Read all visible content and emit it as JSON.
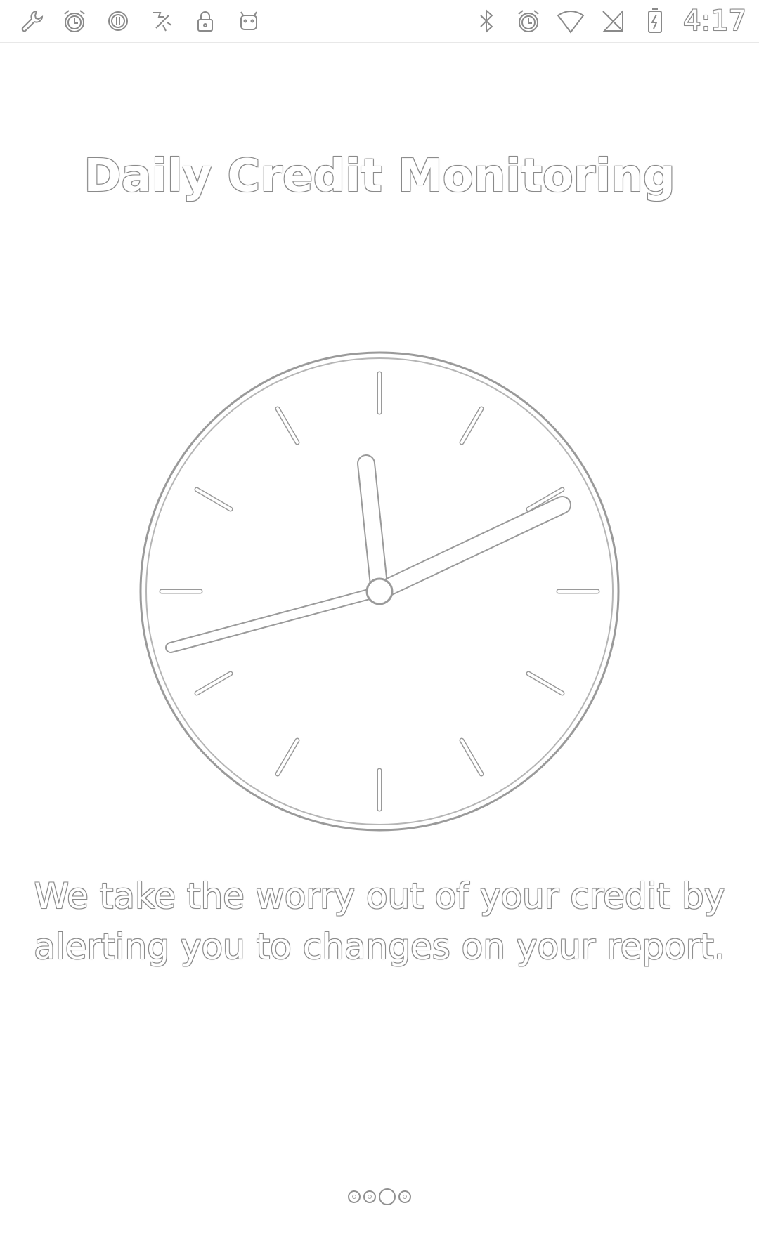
{
  "status_bar": {
    "left_icons": [
      "wrench-icon",
      "alarm-icon",
      "sync-icon",
      "no-sim-icon",
      "lock-icon",
      "android-icon"
    ],
    "right_icons": [
      "bluetooth-icon",
      "alarm-icon",
      "wifi-icon",
      "signal-icon",
      "battery-charging-icon"
    ],
    "time": "4:17"
  },
  "onboarding": {
    "title": "Daily Credit Monitoring",
    "illustration": "clock-icon",
    "description": "We take the worry out of your credit by alerting you to changes on your report."
  },
  "pager": {
    "page_count": 4,
    "current_page": 3
  },
  "colors": {
    "outline": "#8a8a8a",
    "background": "#ffffff"
  }
}
